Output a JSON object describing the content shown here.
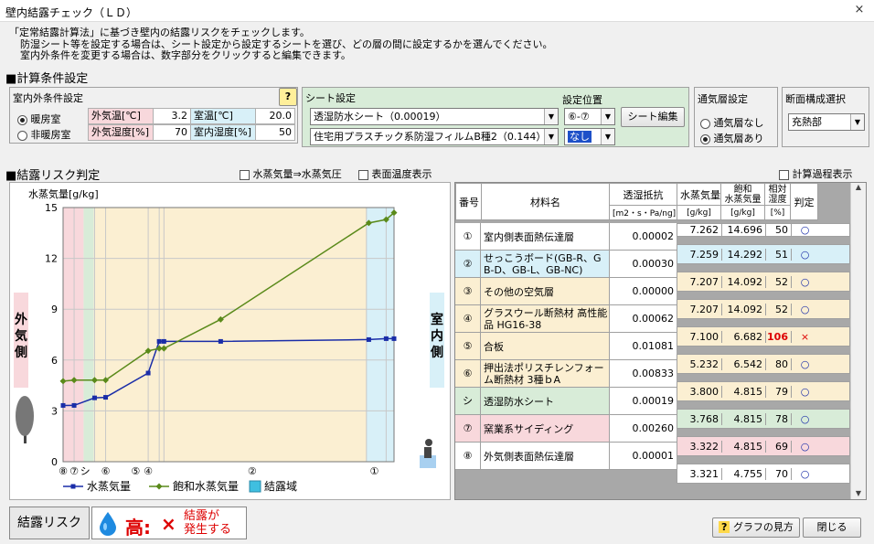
{
  "window": {
    "title": "壁内結露チェック（ＬＤ）",
    "close": "×"
  },
  "intro": [
    "「定常結露計算法」に基づき壁内の結露リスクをチェックします。",
    "防湿シート等を設定する場合は、シート設定から設定するシートを選び、どの層の間に設定するかを選んでください。",
    "室内外条件を変更する場合は、数字部分をクリックすると編集できます。"
  ],
  "conditions": {
    "heading": "■計算条件設定",
    "indoor_outdoor_title": "室内外条件設定",
    "help": "?",
    "radio_heated": "暖房室",
    "radio_unheated": "非暖房室",
    "out_temp_label": "外気温[℃]",
    "out_temp": "3.2",
    "in_temp_label": "室温[℃]",
    "in_temp": "20.0",
    "out_hum_label": "外気湿度[%]",
    "out_hum": "70",
    "in_hum_label": "室内湿度[%]",
    "in_hum": "50"
  },
  "sheet": {
    "title": "シート設定",
    "pos_title": "設定位置",
    "sheet1": "透湿防水シート（0.00019）",
    "sheet2": "住宅用プラスチック系防湿フィルムB種2（0.144）",
    "pos1": "⑥-⑦",
    "pos2": "なし",
    "edit_button": "シート編集"
  },
  "ventilation": {
    "title": "通気層設定",
    "none": "通気層なし",
    "yes": "通気層あり"
  },
  "section": {
    "title": "断面構成選択",
    "value": "充熱部"
  },
  "risk": {
    "heading": "■結露リスク判定",
    "chk_pressure": "水蒸気量⇒水蒸気圧",
    "chk_surface": "表面温度表示",
    "chk_process": "計算過程表示"
  },
  "chart_data": {
    "type": "line",
    "ylabel": "水蒸気量[g/kg]",
    "yticks": [
      "0",
      "3",
      "6",
      "9",
      "12",
      "15"
    ],
    "ylim": [
      0,
      15
    ],
    "outside_label": "外気側",
    "inside_label": "室内側",
    "x": [
      0,
      14,
      40,
      54,
      108,
      122,
      128,
      200,
      388,
      410,
      420
    ],
    "xlabels": [
      "⑧",
      "⑦",
      "シ",
      "⑥",
      "⑤",
      "④",
      "②",
      "①"
    ],
    "series": [
      {
        "name": "水蒸気量",
        "color": "#1a2da8",
        "values": [
          3.321,
          3.322,
          3.768,
          3.8,
          5.232,
          7.1,
          7.1,
          7.1,
          7.207,
          7.262,
          7.262
        ]
      },
      {
        "name": "飽和水蒸気量",
        "color": "#5a8a1a",
        "values": [
          4.755,
          4.815,
          4.815,
          4.815,
          6.542,
          6.682,
          6.682,
          8.4,
          14.092,
          14.292,
          14.696
        ]
      }
    ],
    "legend_cond": "結露域",
    "bands": [
      {
        "from": 0,
        "to": 26,
        "color": "#f8d8dc"
      },
      {
        "from": 26,
        "to": 39,
        "color": "#d8ecd8"
      },
      {
        "from": 39,
        "to": 122,
        "color": "#fbefd2"
      },
      {
        "from": 122,
        "to": 385,
        "color": "#fbefd2"
      },
      {
        "from": 385,
        "to": 420,
        "color": "#d8f0f8"
      }
    ]
  },
  "table": {
    "headers": {
      "no": "番号",
      "mat": "材料名",
      "res": "透湿抵抗",
      "res_unit": "[m2・s・Pa/ng]",
      "vap": "水蒸気量",
      "vap_unit": "[g/kg]",
      "sat": "飽和\n水蒸気量",
      "sat_unit": "[g/kg]",
      "rh": "相対\n湿度",
      "rh_unit": "[%]",
      "judge": "判定"
    },
    "rows": [
      {
        "no": "①",
        "name": "室内側表面熱伝達層",
        "res": "0.00002",
        "bg": "#ffffff"
      },
      {
        "no": "②",
        "name": "せっこうボード(GB-R、GB-D、GB-L、GB-NC)",
        "res": "0.00030",
        "bg": "#d8f0f8"
      },
      {
        "no": "③",
        "name": "その他の空気層",
        "res": "0.00000",
        "bg": "#fbefd2"
      },
      {
        "no": "④",
        "name": "グラスウール断熱材 高性能品 HG16-38",
        "res": "0.00062",
        "bg": "#fbefd2"
      },
      {
        "no": "⑤",
        "name": "合板",
        "res": "0.01081",
        "bg": "#fbefd2"
      },
      {
        "no": "⑥",
        "name": "押出法ポリスチレンフォーム断熱材 3種ｂA",
        "res": "0.00833",
        "bg": "#fbefd2"
      },
      {
        "no": "シ",
        "name": "透湿防水シート",
        "res": "0.00019",
        "bg": "#d8ecd8"
      },
      {
        "no": "⑦",
        "name": "窯業系サイディング",
        "res": "0.00260",
        "bg": "#f8d8dc"
      },
      {
        "no": "⑧",
        "name": "外気側表面熱伝達層",
        "res": "0.00001",
        "bg": "#ffffff"
      }
    ],
    "bounds": [
      {
        "vap": "7.262",
        "sat": "14.696",
        "rh": "50",
        "j": "○"
      },
      {
        "vap": "7.259",
        "sat": "14.292",
        "rh": "51",
        "j": "○"
      },
      {
        "vap": "7.207",
        "sat": "14.092",
        "rh": "52",
        "j": "○"
      },
      {
        "vap": "7.207",
        "sat": "14.092",
        "rh": "52",
        "j": "○"
      },
      {
        "vap": "7.100",
        "sat": "6.682",
        "rh": "106",
        "j": "×"
      },
      {
        "vap": "5.232",
        "sat": "6.542",
        "rh": "80",
        "j": "○"
      },
      {
        "vap": "3.800",
        "sat": "4.815",
        "rh": "79",
        "j": "○"
      },
      {
        "vap": "3.768",
        "sat": "4.815",
        "rh": "78",
        "j": "○"
      },
      {
        "vap": "3.322",
        "sat": "4.815",
        "rh": "69",
        "j": "○"
      },
      {
        "vap": "3.321",
        "sat": "4.755",
        "rh": "70",
        "j": "○"
      }
    ]
  },
  "result": {
    "label": "結露リスク",
    "level": "高:",
    "mark": "×",
    "message": "結露が\n発生する"
  },
  "buttons": {
    "graph_help": "グラフの見方",
    "close": "閉じる"
  }
}
